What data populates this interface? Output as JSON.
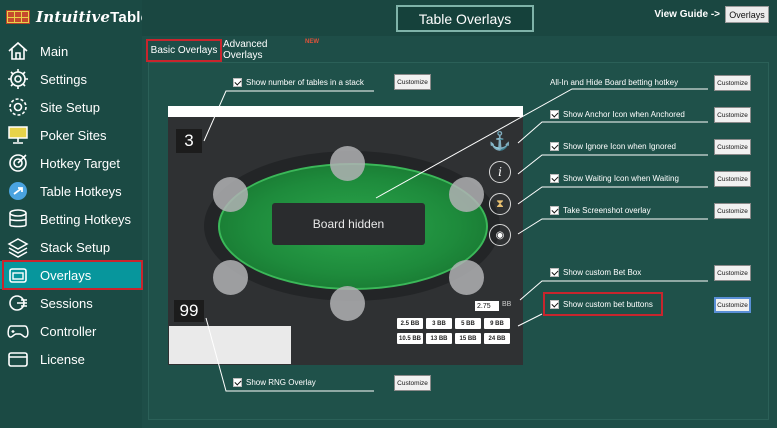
{
  "app": {
    "brand_italic": "Intuitive",
    "brand_bold": "Tables"
  },
  "sidebar": {
    "items": [
      {
        "label": "Main",
        "icon": "home-icon"
      },
      {
        "label": "Settings",
        "icon": "gear-icon"
      },
      {
        "label": "Site Setup",
        "icon": "site-gear-icon"
      },
      {
        "label": "Poker Sites",
        "icon": "monitor-icon"
      },
      {
        "label": "Hotkey Target",
        "icon": "target-icon"
      },
      {
        "label": "Table Hotkeys",
        "icon": "arrow-circle-icon"
      },
      {
        "label": "Betting Hotkeys",
        "icon": "database-icon"
      },
      {
        "label": "Stack Setup",
        "icon": "layers-icon"
      },
      {
        "label": "Overlays",
        "icon": "overlay-icon",
        "active": true
      },
      {
        "label": "Sessions",
        "icon": "sessions-icon"
      },
      {
        "label": "Controller",
        "icon": "gamepad-icon"
      },
      {
        "label": "License",
        "icon": "card-icon"
      }
    ]
  },
  "header": {
    "title": "Table Overlays",
    "view_guide": "View Guide ->",
    "guide_button": "Overlays"
  },
  "tabs": {
    "basic": "Basic Overlays",
    "advanced": "Advanced Overlays",
    "new_badge": "NEW"
  },
  "preview": {
    "stack_count": "3",
    "board_text": "Board hidden",
    "bottom_count": "99",
    "bet_value": "2.75",
    "bet_unit": "BB",
    "bet_buttons": [
      "2.5 BB",
      "3 BB",
      "5 BB",
      "9 BB",
      "10.5 BB",
      "13 BB",
      "15 BB",
      "24 BB"
    ]
  },
  "options": {
    "stack_count": "Show number of tables in a stack",
    "hotkey": "All-In and Hide Board betting hotkey",
    "anchor": "Show Anchor Icon when Anchored",
    "ignore": "Show Ignore Icon when Ignored",
    "waiting": "Show Waiting Icon when Waiting",
    "screenshot": "Take Screenshot overlay",
    "bet_box": "Show custom Bet Box",
    "bet_buttons": "Show custom bet buttons",
    "rng": "Show RNG Overlay"
  },
  "customize_label": "Customize",
  "colors": {
    "active": "#07969c",
    "highlight": "#c8252d",
    "felt": "#1e8b3c"
  }
}
